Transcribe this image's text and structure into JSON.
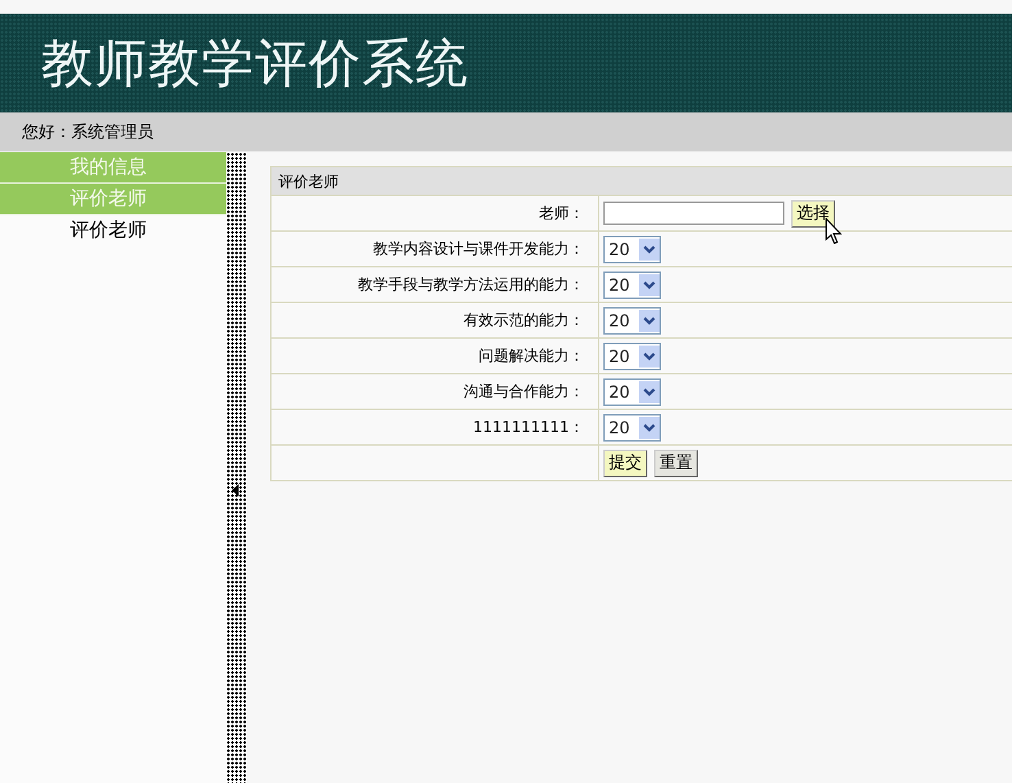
{
  "header": {
    "title": "教师教学评价系统"
  },
  "greeting": "您好：系统管理员",
  "sidebar": {
    "items": [
      {
        "label": "我的信息",
        "kind": "group"
      },
      {
        "label": "评价老师",
        "kind": "group"
      },
      {
        "label": "评价老师",
        "kind": "link"
      }
    ]
  },
  "form": {
    "title": "评价老师",
    "teacher": {
      "label": "老师：",
      "button": {
        "label": "选择",
        "kind": "primary"
      }
    },
    "criteria": [
      {
        "label": "教学内容设计与课件开发能力：",
        "value": "20"
      },
      {
        "label": "教学手段与教学方法运用的能力：",
        "value": "20"
      },
      {
        "label": "有效示范的能力：",
        "value": "20"
      },
      {
        "label": "问题解决能力：",
        "value": "20"
      },
      {
        "label": "沟通与合作能力：",
        "value": "20"
      },
      {
        "label": "1111111111：",
        "value": "20"
      }
    ],
    "buttons": [
      {
        "label": "提交",
        "kind": "primary"
      },
      {
        "label": "重置",
        "kind": "secondary"
      }
    ]
  }
}
